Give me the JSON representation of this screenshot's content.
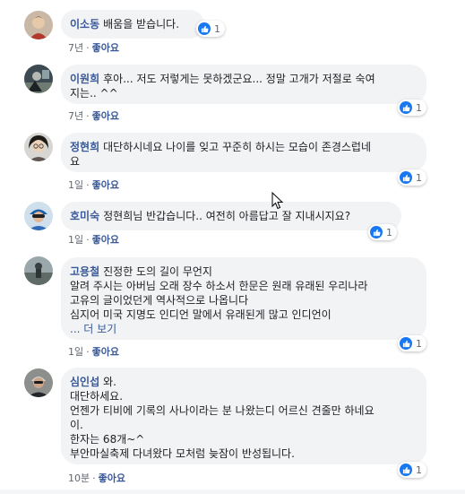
{
  "colors": {
    "author": "#385898",
    "bubble": "#f2f3f5",
    "meta": "#616770",
    "like": "#1877f2"
  },
  "comments": [
    {
      "author": "이소동",
      "text": "배움을 받습니다.",
      "time": "7년",
      "like_label": "좋아요",
      "reaction_icon": "like-icon",
      "reaction_count": "1"
    },
    {
      "author": "이원희",
      "text": "후아... 저도 저렇게는 못하겠군요... 정말 고개가 저절로 숙여\n지는.. ^^",
      "time": "7년",
      "like_label": "좋아요",
      "reaction_icon": "like-icon",
      "reaction_count": "1"
    },
    {
      "author": "정현희",
      "text": "대단하시네요 나이를 잊고 꾸준히 하시는 모습이 존경스럽네\n요",
      "time": "1일",
      "like_label": "좋아요",
      "reaction_icon": "like-icon",
      "reaction_count": "1"
    },
    {
      "author": "호미숙",
      "text": "정현희님 반갑습니다.. 여전히 아름답고 잘 지내시지요?",
      "time": "1일",
      "like_label": "좋아요",
      "reaction_icon": "like-icon",
      "reaction_count": "1"
    },
    {
      "author": "고용철",
      "text": "진정한 도의 길이 무언지\n알려 주시는 아버님 오래 장수 하소서 한문은 원래 유래된 우리나라\n고유의 글이었던게 역사적으로 나옵니다\n심지어 미국 지명도 인디언 말에서 유래된게 많고 인디언이",
      "more": "... 더 보기",
      "time": "1일",
      "like_label": "좋아요",
      "reaction_icon": "like-icon",
      "reaction_count": "1"
    },
    {
      "author": "심인섭",
      "text": "와.\n대단하세요.\n언젠가 티비에 기록의 사나이라는 분 나왔는디 어르신 견줄만 하네요\n이.\n한자는 68개~^\n부안마실축제 다녀왔다 모처럼 늦잠이 반성됩니다.",
      "time": "10분",
      "like_label": "좋아요",
      "reaction_icon": "like-icon",
      "reaction_count": "1"
    }
  ]
}
